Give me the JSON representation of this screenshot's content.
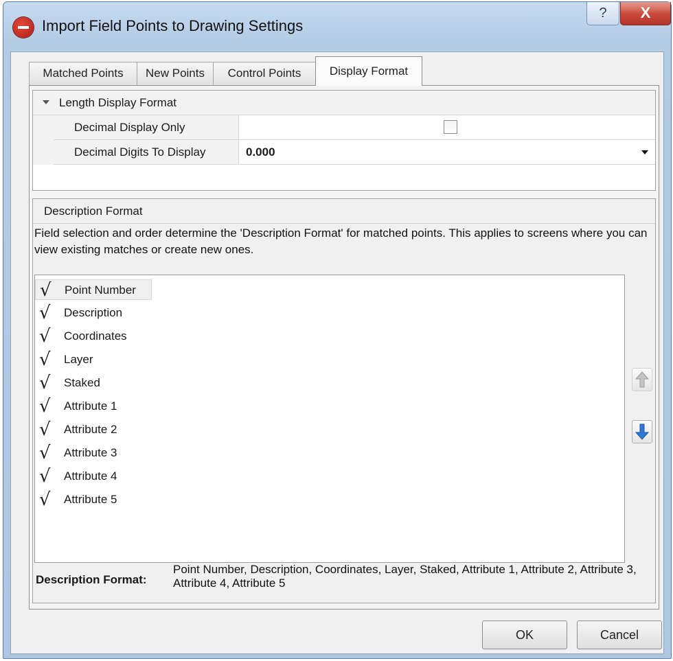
{
  "window": {
    "title": "Import Field Points to Drawing Settings",
    "help_glyph": "?",
    "close_glyph": "X"
  },
  "tabs": [
    {
      "label": "Matched Points",
      "active": false
    },
    {
      "label": "New Points",
      "active": false
    },
    {
      "label": "Control Points",
      "active": false
    },
    {
      "label": "Display Format",
      "active": true
    }
  ],
  "length_display": {
    "header": "Length Display Format",
    "rows": [
      {
        "label": "Decimal Display Only",
        "checked": false
      },
      {
        "label": "Decimal Digits To Display",
        "value": "0.000"
      }
    ]
  },
  "description_format": {
    "header": "Description Format",
    "help_text": "Field selection and order determine the 'Description Format' for matched points. This applies to screens where you can view existing matches or create new ones.",
    "fields": [
      {
        "label": "Point Number",
        "checked": true,
        "selected": true
      },
      {
        "label": "Description",
        "checked": true
      },
      {
        "label": "Coordinates",
        "checked": true
      },
      {
        "label": "Layer",
        "checked": true
      },
      {
        "label": "Staked",
        "checked": true
      },
      {
        "label": "Attribute 1",
        "checked": true
      },
      {
        "label": "Attribute 2",
        "checked": true
      },
      {
        "label": "Attribute 3",
        "checked": true
      },
      {
        "label": "Attribute 4",
        "checked": true
      },
      {
        "label": "Attribute 5",
        "checked": true
      }
    ],
    "summary_label": "Description Format:",
    "summary_value": "Point Number, Description, Coordinates, Layer, Staked, Attribute 1, Attribute 2, Attribute 3, Attribute 4, Attribute 5"
  },
  "buttons": {
    "ok": "OK",
    "cancel": "Cancel"
  },
  "icons": {
    "app": "hilti-logo-icon",
    "move_up": "arrow-up-icon",
    "move_down": "arrow-down-icon",
    "check": "checkmark-icon",
    "expand": "collapse-triangle-icon",
    "dropdown": "dropdown-arrow-icon"
  },
  "colors": {
    "move_down_arrow": "#2f78d6",
    "move_up_arrow_disabled": "#b5b5b5",
    "close_button": "#c9493a"
  }
}
